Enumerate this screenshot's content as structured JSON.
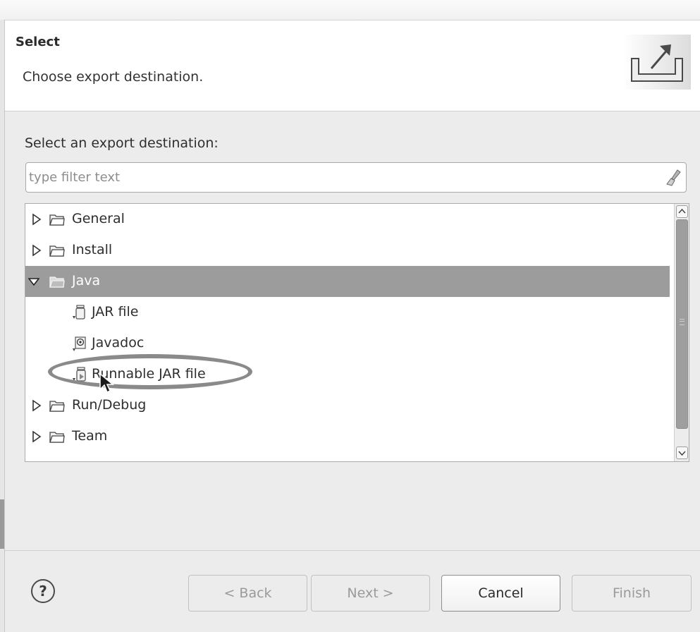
{
  "header": {
    "title": "Select",
    "description": "Choose export destination.",
    "icon": "export-icon"
  },
  "content": {
    "label": "Select an export destination:",
    "filter": {
      "placeholder": "type filter text",
      "value": ""
    },
    "tree": [
      {
        "label": "General",
        "type": "folder",
        "expanded": false
      },
      {
        "label": "Install",
        "type": "folder",
        "expanded": false
      },
      {
        "label": "Java",
        "type": "folder",
        "expanded": true,
        "selected": true
      },
      {
        "label": "JAR file",
        "type": "leaf",
        "icon": "jar-icon"
      },
      {
        "label": "Javadoc",
        "type": "leaf",
        "icon": "javadoc-icon"
      },
      {
        "label": "Runnable JAR file",
        "type": "leaf",
        "icon": "runnable-jar-icon",
        "highlighted": true
      },
      {
        "label": "Run/Debug",
        "type": "folder",
        "expanded": false
      },
      {
        "label": "Team",
        "type": "folder",
        "expanded": false
      }
    ]
  },
  "buttons": {
    "back": "< Back",
    "next": "Next >",
    "cancel": "Cancel",
    "finish": "Finish",
    "help": "?"
  },
  "colors": {
    "selection": "#9c9c9c",
    "highlight_ring": "#8a8a8a",
    "dialog_bg": "#ececec"
  }
}
